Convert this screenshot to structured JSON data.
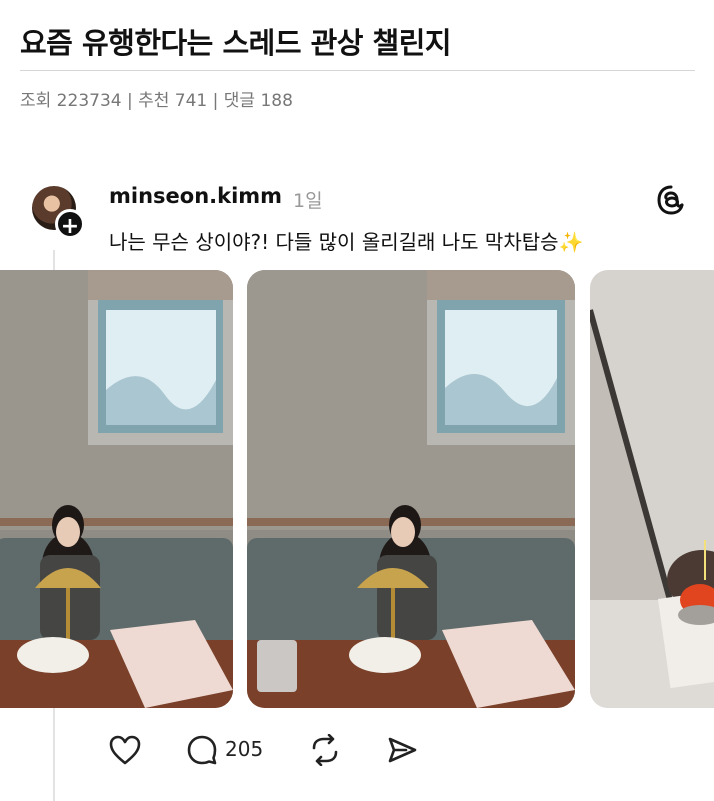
{
  "article": {
    "title": "요즘 유행한다는 스레드 관상 챌린지",
    "meta": "조회 223734 | 추천 741 | 댓글 188"
  },
  "post": {
    "username": "minseon.kimm",
    "time": "1일",
    "caption": "나는 무슨 상이야?! 다들 많이 올리길래 나도 막차탑승✨",
    "reply_count": "205"
  },
  "icons": {
    "app": "threads-logo-icon",
    "actions": [
      "heart-icon",
      "comment-icon",
      "repost-icon",
      "share-icon"
    ]
  }
}
